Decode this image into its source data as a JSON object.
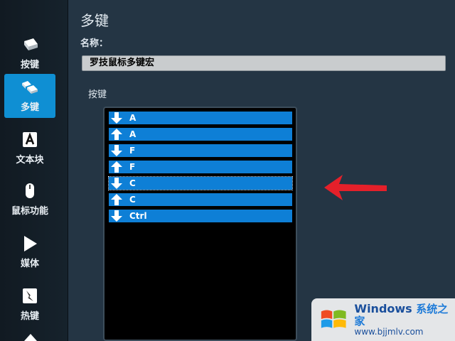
{
  "sidebar": {
    "items": [
      {
        "label": "按键",
        "icon": "key-icon",
        "active": false
      },
      {
        "label": "多键",
        "icon": "multi-key-icon",
        "active": true
      },
      {
        "label": "文本块",
        "icon": "text-block-icon",
        "active": false
      },
      {
        "label": "鼠标功能",
        "icon": "mouse-icon",
        "active": false
      },
      {
        "label": "媒体",
        "icon": "play-icon",
        "active": false
      },
      {
        "label": "热键",
        "icon": "hotkey-icon",
        "active": false
      }
    ]
  },
  "main": {
    "title": "多键",
    "name_label": "名称：",
    "name_value": "罗技鼠标多键宏",
    "keys_label": "按键",
    "keys": [
      {
        "dir": "down",
        "key": "A"
      },
      {
        "dir": "up",
        "key": "A"
      },
      {
        "dir": "down",
        "key": "F"
      },
      {
        "dir": "up",
        "key": "F"
      },
      {
        "dir": "down",
        "key": "C",
        "selected": true
      },
      {
        "dir": "up",
        "key": "C"
      },
      {
        "dir": "down",
        "key": "Ctrl"
      }
    ]
  },
  "watermark": {
    "brand": "Windows",
    "brand_sub": "系统之家",
    "url": "www.bjjmlv.com"
  },
  "colors": {
    "accent": "#0f8fd3",
    "row": "#0e7fd6",
    "annotation_arrow": "#e5202a"
  }
}
